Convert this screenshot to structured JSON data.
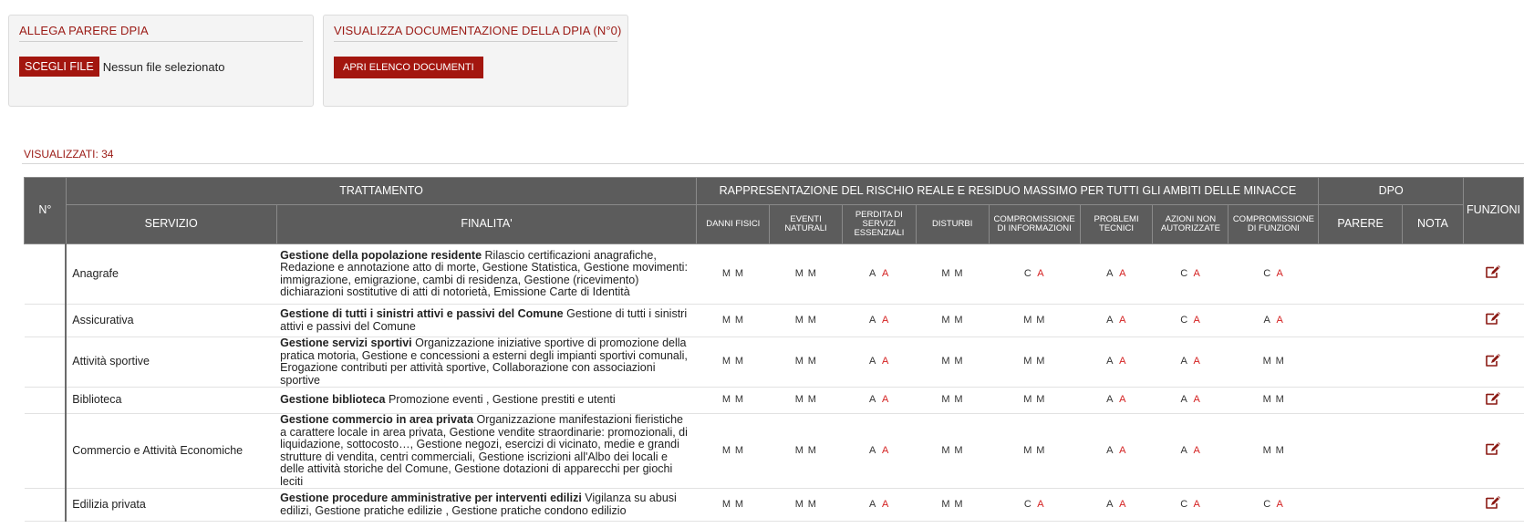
{
  "upload_panel": {
    "title": "ALLEGA PARERE DPIA",
    "choose_button": "SCEGLI FILE",
    "file_status": "Nessun file selezionato"
  },
  "docs_panel": {
    "title": "VISUALIZZA DOCUMENTAZIONE DELLA DPIA (N°0)",
    "open_button": "APRI ELENCO DOCUMENTI"
  },
  "results": {
    "count_label": "VISUALIZZATI: 34"
  },
  "table": {
    "headers": {
      "number": "N°",
      "treatment": "TRATTAMENTO",
      "risk": "RAPPRESENTAZIONE DEL RISCHIO REALE E RESIDUO MASSIMO PER TUTTI GLI AMBITI DELLE MINACCE",
      "dpo": "DPO",
      "functions": "FUNZIONI",
      "service": "SERVIZIO",
      "purpose": "FINALITA'",
      "risk_columns": [
        "DANNI FISICI",
        "EVENTI NATURALI",
        "PERDITA DI SERVIZI ESSENZIALI",
        "DISTURBI",
        "COMPROMISSIONE DI INFORMAZIONI",
        "PROBLEMI TECNICI",
        "AZIONI NON AUTORIZZATE",
        "COMPROMISSIONE DI FUNZIONI"
      ],
      "dpo_opinion": "PARERE",
      "dpo_note": "NOTA"
    },
    "risk_colors": {
      "normal": "#333333",
      "high": "#d42020"
    },
    "rows": [
      {
        "service": "Anagrafe",
        "purpose_title": "Gestione della popolazione residente",
        "purpose_text": "Rilascio certificazioni anagrafiche, Redazione e annotazione atto di morte, Gestione Statistica, Gestione movimenti: immigrazione, emigrazione, cambi di residenza, Gestione (ricevimento) dichiarazioni sostitutive di atti di notorietà, Emissione Carte di Identità",
        "risks": [
          [
            "M",
            "M"
          ],
          [
            "M",
            "M"
          ],
          [
            "A",
            "A"
          ],
          [
            "M",
            "M"
          ],
          [
            "C",
            "A"
          ],
          [
            "A",
            "A"
          ],
          [
            "C",
            "A"
          ],
          [
            "C",
            "A"
          ]
        ],
        "icon": "edit-icon"
      },
      {
        "service": "Assicurativa",
        "purpose_title": "Gestione di tutti i sinistri attivi e passivi del Comune",
        "purpose_text": "Gestione di tutti i sinistri attivi e passivi del Comune",
        "risks": [
          [
            "M",
            "M"
          ],
          [
            "M",
            "M"
          ],
          [
            "A",
            "A"
          ],
          [
            "M",
            "M"
          ],
          [
            "M",
            "M"
          ],
          [
            "A",
            "A"
          ],
          [
            "C",
            "A"
          ],
          [
            "A",
            "A"
          ]
        ],
        "icon": "edit-icon"
      },
      {
        "service": "Attività sportive",
        "purpose_title": "Gestione servizi sportivi",
        "purpose_text": "Organizzazione iniziative sportive di promozione della pratica motoria, Gestione e concessioni a esterni degli impianti sportivi comunali, Erogazione contributi per attività sportive, Collaborazione con associazioni sportive",
        "risks": [
          [
            "M",
            "M"
          ],
          [
            "M",
            "M"
          ],
          [
            "A",
            "A"
          ],
          [
            "M",
            "M"
          ],
          [
            "M",
            "M"
          ],
          [
            "A",
            "A"
          ],
          [
            "A",
            "A"
          ],
          [
            "M",
            "M"
          ]
        ],
        "icon": "edit-icon"
      },
      {
        "service": "Biblioteca",
        "purpose_title": "Gestione biblioteca",
        "purpose_text": "Promozione eventi , Gestione prestiti e utenti",
        "risks": [
          [
            "M",
            "M"
          ],
          [
            "M",
            "M"
          ],
          [
            "A",
            "A"
          ],
          [
            "M",
            "M"
          ],
          [
            "M",
            "M"
          ],
          [
            "A",
            "A"
          ],
          [
            "A",
            "A"
          ],
          [
            "M",
            "M"
          ]
        ],
        "icon": "edit-icon"
      },
      {
        "service": "Commercio e Attività Economiche",
        "purpose_title": "Gestione commercio in area privata",
        "purpose_text": "Organizzazione manifestazioni fieristiche a carattere locale in area privata, Gestione vendite straordinarie: promozionali, di liquidazione, sottocosto…, Gestione negozi, esercizi di vicinato, medie e grandi strutture di vendita, centri commerciali, Gestione iscrizioni all'Albo dei locali e delle attività storiche del Comune, Gestione dotazioni di apparecchi per giochi leciti",
        "risks": [
          [
            "M",
            "M"
          ],
          [
            "M",
            "M"
          ],
          [
            "A",
            "A"
          ],
          [
            "M",
            "M"
          ],
          [
            "M",
            "M"
          ],
          [
            "A",
            "A"
          ],
          [
            "A",
            "A"
          ],
          [
            "M",
            "M"
          ]
        ],
        "icon": "edit-icon"
      },
      {
        "service": "Edilizia privata",
        "purpose_title": "Gestione procedure amministrative per interventi edilizi",
        "purpose_text": "Vigilanza su abusi edilizi, Gestione pratiche edilizie , Gestione pratiche condono edilizio",
        "risks": [
          [
            "M",
            "M"
          ],
          [
            "M",
            "M"
          ],
          [
            "A",
            "A"
          ],
          [
            "M",
            "M"
          ],
          [
            "C",
            "A"
          ],
          [
            "A",
            "A"
          ],
          [
            "C",
            "A"
          ],
          [
            "C",
            "A"
          ]
        ],
        "icon": "edit-icon"
      }
    ]
  }
}
